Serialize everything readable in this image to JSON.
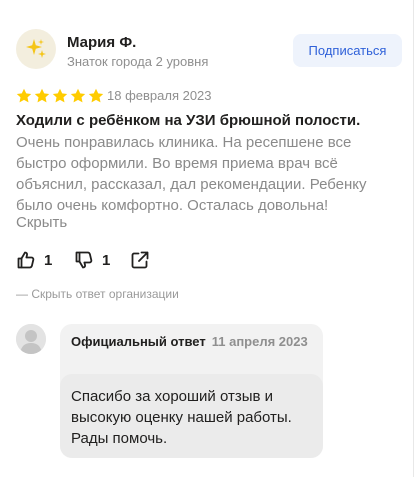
{
  "review": {
    "author": {
      "name": "Мария Ф.",
      "level": "Знаток города 2 уровня",
      "avatar_icon": "sparkles-icon"
    },
    "subscribe_label": "Подписаться",
    "rating": 5,
    "date": "18 февраля 2023",
    "title": "Ходили с ребёнком на УЗИ брюшной полости.",
    "text": "Очень понравилась клиника. На ресепшене все быстро оформили. Во время приема врач всё объяснил, рассказал, дал рекомендации. Ребенку было очень комфортно. Осталась довольна!",
    "collapse_label": "Скрыть",
    "likes": "1",
    "dislikes": "1",
    "hide_answer_label": "— Скрыть ответ организации"
  },
  "org_answer": {
    "label": "Официальный ответ",
    "date": "11 апреля 2023",
    "text": "Спасибо за хороший отзыв и высокую оценку нашей работы. Рады помочь."
  },
  "colors": {
    "star": "#fc0",
    "subscribe_bg": "#eef3fc",
    "subscribe_text": "#2f61d9",
    "muted_text": "#8a8a8a"
  }
}
